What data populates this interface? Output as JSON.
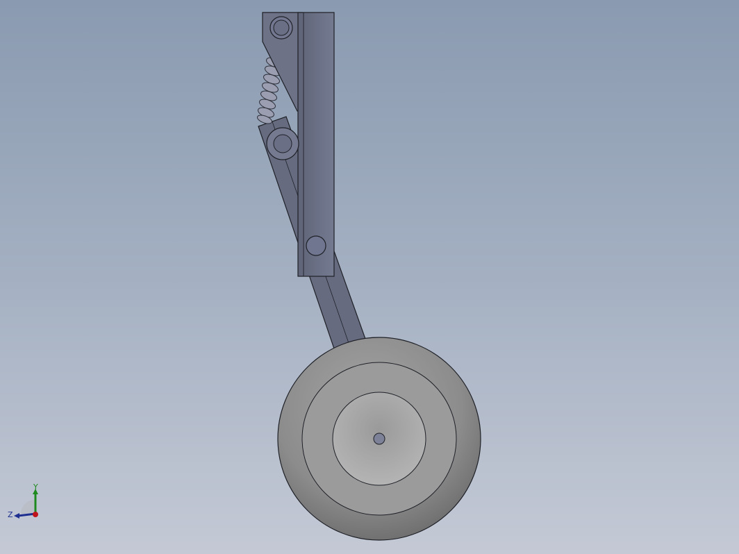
{
  "viewport": {
    "background_top": "#8a9ab0",
    "background_bottom": "#c4c9d5"
  },
  "model": {
    "assembly": "landing-gear",
    "parts": [
      "main-strut",
      "upper-bracket",
      "compression-spring",
      "trailing-arm",
      "wheel-tire",
      "wheel-hub"
    ],
    "part_color": "#6d7287",
    "edge_color": "#1e2026",
    "tire_color": "#8f8f8f",
    "hub_color": "#a8a8a8"
  },
  "triad": {
    "y_label": "Y",
    "z_label": "Z",
    "y_color": "#1f8a1f",
    "z_color": "#1e2f8f",
    "x_color": "#c0141c"
  }
}
